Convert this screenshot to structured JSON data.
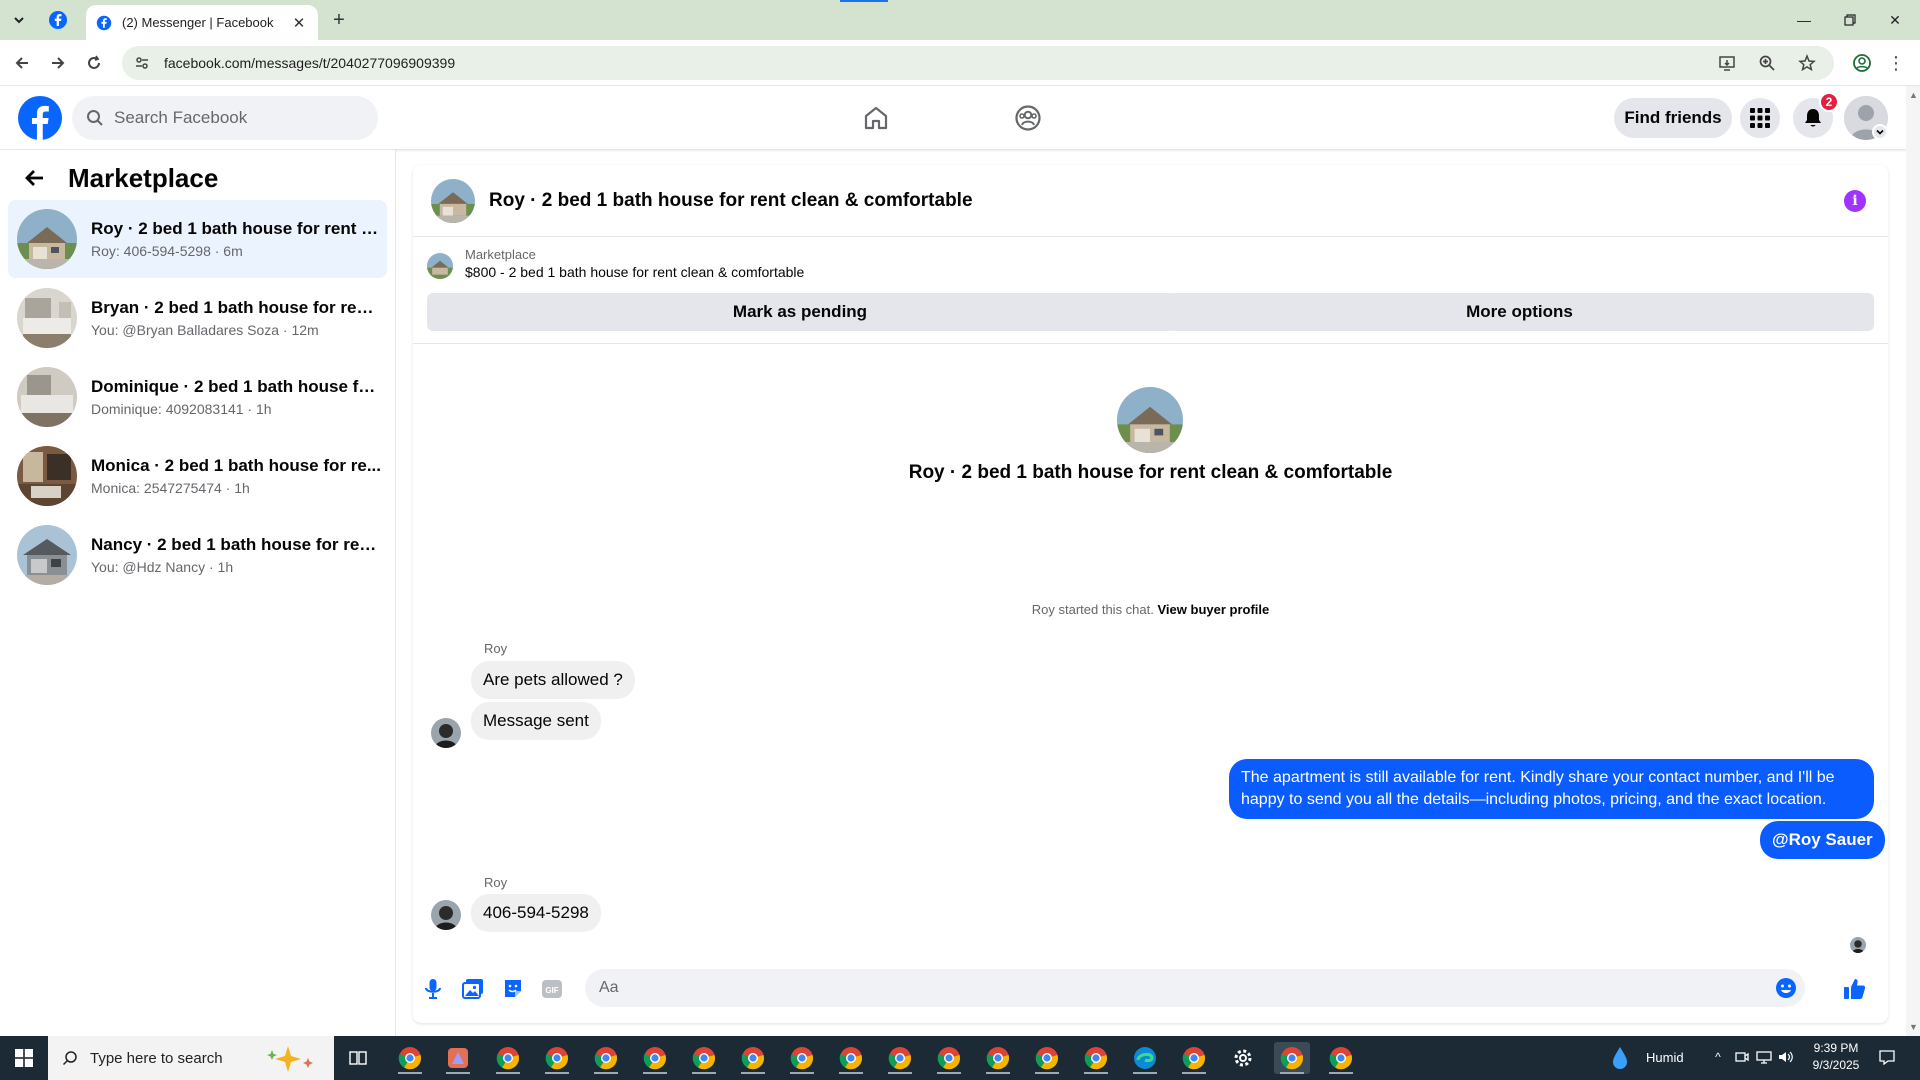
{
  "browser": {
    "tab_title": "(2) Messenger | Facebook",
    "url": "facebook.com/messages/t/2040277096909399"
  },
  "fb_header": {
    "search_placeholder": "Search Facebook",
    "find_friends_label": "Find friends",
    "notification_count": "2",
    "brand_color": "#0866ff"
  },
  "sidebar": {
    "title": "Marketplace",
    "conversations": [
      {
        "name": "Roy · 2 bed 1 bath house for rent c...",
        "preview": "Roy: 406-594-5298 · 6m"
      },
      {
        "name": "Bryan · 2 bed 1 bath house for rent...",
        "preview": "You: @Bryan Balladares Soza · 12m"
      },
      {
        "name": "Dominique · 2 bed 1 bath house fo...",
        "preview": "Dominique: 4092083141 · 1h"
      },
      {
        "name": "Monica · 2 bed 1 bath house for re...",
        "preview": "Monica: 2547275474 · 1h"
      },
      {
        "name": "Nancy · 2 bed 1 bath house for ren...",
        "preview": "You: @Hdz Nancy · 1h"
      }
    ]
  },
  "chat": {
    "title": "Roy · 2 bed 1 bath house for rent clean & comfortable",
    "listing_label": "Marketplace",
    "listing_price_title": "$800 - 2 bed 1 bath house for rent clean & comfortable",
    "mark_pending_label": "Mark as pending",
    "more_options_label": "More options",
    "intro_title": "Roy · 2 bed 1 bath house for rent clean & comfortable",
    "started_text": "Roy started this chat.",
    "view_profile_label": "View buyer profile",
    "messages": [
      {
        "sender": "Roy",
        "text": "Are pets allowed ?"
      },
      {
        "text": "Message sent"
      },
      {
        "text": "The apartment is still available for rent. Kindly share your contact number, and I'll be happy to send you all the details—including photos, pricing, and the exact location."
      },
      {
        "text": "@Roy Sauer"
      },
      {
        "sender": "Roy",
        "text": "406-594-5298"
      }
    ],
    "composer_placeholder": "Aa",
    "accent_color": "#0a5cff"
  },
  "taskbar": {
    "search_placeholder": "Type here to search",
    "weather": "Humid",
    "time": "9:39 PM",
    "date": "9/3/2025"
  }
}
